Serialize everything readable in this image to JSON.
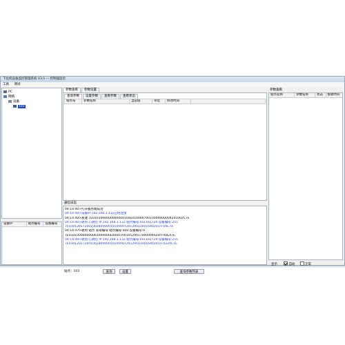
{
  "window": {
    "title": "下位机设备监控管理系统 V3.0 — 控制器监控"
  },
  "menu": [
    "工具",
    "测试"
  ],
  "tree": [
    {
      "label": "PC",
      "level": 0
    },
    {
      "label": "网络",
      "level": 0
    },
    {
      "label": "设备",
      "level": 1
    },
    {
      "label": "103",
      "level": 2,
      "selected": true
    }
  ],
  "left_table": {
    "headers": [
      "设备IP",
      "站点编号",
      "设备编号"
    ]
  },
  "main_tabs": [
    "参数查看",
    "参数设置"
  ],
  "sub_tabs": [
    "查询参数",
    "设置参数",
    "查看参数",
    "查看状态"
  ],
  "param_table": {
    "headers": [
      "站点号",
      "参数名称",
      "当前值",
      "单位",
      "修改时间"
    ]
  },
  "controls": {
    "station_label": "站点：103",
    "query_button": "查询",
    "set_button": "设置",
    "query_list_button": "查询参数列表"
  },
  "log": {
    "title": "通信日志",
    "lines": [
      {
        "text": "04:14:40>打开服务端成功",
        "blue": false
      },
      {
        "text": "04:14:40>设备IP:192.168.1.132已经连接",
        "blue": true
      },
      {
        "text": "04:14:40>发送 7E0101000000000000100E01000070010000000004201002C7E",
        "blue": false
      },
      {
        "text": "04:14:40>收到 心跳包 IP:192.168.1.132  站点编号:0x1161720  设备编号:255",
        "blue": true
      },
      {
        "text": "7E0101201720010028000001010000720129011001640201FF00C7E",
        "blue": true
      },
      {
        "text": "04:14:47>收到 站点 获取编号  站点编号:0x0  设备编号:0",
        "blue": false
      },
      {
        "text": "7E010100000000001000000E000070010129017000004020FF00EA7E",
        "blue": false
      },
      {
        "text": "04:14:49>收到 心跳包 IP:192.168.1.132  站点编号:0x1161720  设备编号:255",
        "blue": true
      },
      {
        "text": "7E0101201720010028000001010000720129011001640201FF0224C7E",
        "blue": true
      }
    ]
  },
  "right_panel": {
    "title": "参数查看",
    "headers": [
      "站点名称",
      "参数名称",
      "状态",
      "接收时间"
    ],
    "options": [
      {
        "label": "显示",
        "checked": false
      },
      {
        "label": "自动",
        "checked": true
      },
      {
        "label": "正常",
        "checked": false
      }
    ]
  }
}
